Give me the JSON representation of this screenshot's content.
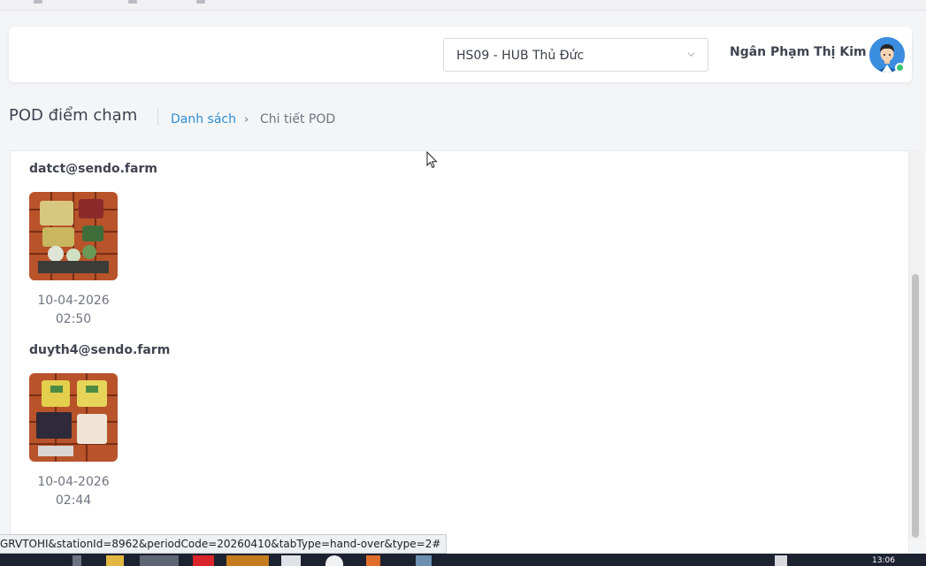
{
  "header": {
    "station_select": {
      "value": "HS09 - HUB Thủ Đức"
    },
    "user": {
      "name": "Ngân Phạm Thị Kim",
      "online": true
    }
  },
  "page": {
    "title": "POD điểm chạm",
    "breadcrumb": {
      "link": "Danh sách",
      "separator": "›",
      "current": "Chi tiết POD"
    }
  },
  "pods": [
    {
      "user": "datct@sendo.farm",
      "date": "10-04-2026",
      "time": "02:50",
      "photo": "pod-photo-crate"
    },
    {
      "user": "duyth4@sendo.farm",
      "date": "10-04-2026",
      "time": "02:44",
      "photo": "pod-photo-crate"
    }
  ],
  "status_bar": {
    "url": "GRVTOHI&stationId=8962&periodCode=20260410&tabType=hand-over&type=2#"
  },
  "taskbar": {
    "clock": "13:06"
  },
  "colors": {
    "link": "#2f8fd2",
    "online": "#35c46a",
    "avatar_bg": "#3b8de0",
    "crate": "#b8532a"
  }
}
